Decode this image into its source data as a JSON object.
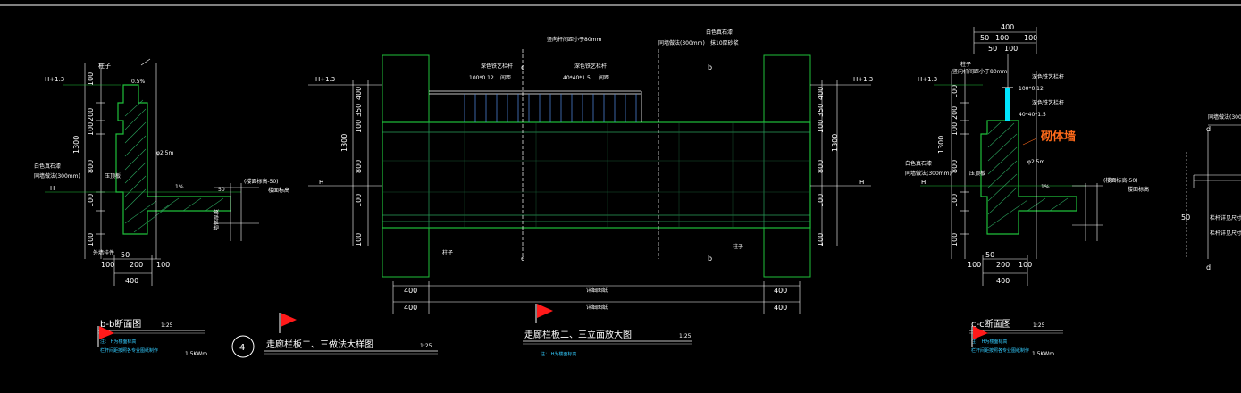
{
  "colors": {
    "background": "#000000",
    "line": "#ffffff",
    "structure": "#1fbf3a",
    "dim_green": "#2aa05a",
    "railing": "#4a7fd0",
    "cyan": "#00e5ff",
    "flag": "#ff1a1a",
    "annotation": "#ff6a1a"
  },
  "section_b": {
    "title": "b-b断面图",
    "scale": "1:25",
    "note": "注：  H为楼面标高",
    "note2": "栏杆间距按照各专业图纸制作",
    "sheet": "1.5KWm",
    "top_label": "柱子",
    "level_top": "H+1.3",
    "level_base": "H",
    "slope": "0.5%",
    "dims_v": [
      "100",
      "200",
      "100",
      "1300",
      "800",
      "100",
      "100",
      "100"
    ],
    "dims_h": [
      "100",
      "50",
      "200",
      "100"
    ],
    "total_h": "400",
    "label_finish": "白色真石漆",
    "label_wall": "同墙做法(300mm)",
    "label_cap": "压顶板",
    "label_rebar": "φ2.5m",
    "label_ground": "外墙保温",
    "label_floor": "(楼面标高-50)",
    "label_floor2": "楼面标高",
    "label_slab": "50",
    "label_side": "外墙挂件",
    "label_fix": "墙体",
    "label_side2": "墙体厚度",
    "label_ratio": "1%"
  },
  "section_c": {
    "title": "c-c断面图",
    "scale": "1:25",
    "note": "注：  H为楼面标高",
    "note2": "栏杆间距按照各专业图纸制作",
    "sheet": "1.5KWm",
    "top_label": "柱子",
    "level_top": "H+1.3",
    "level_base": "H",
    "red_label": "砌体墙",
    "top_dim": "400",
    "top_dims": [
      "50",
      "100",
      "100",
      "50",
      "100"
    ],
    "rail_a": "深色铁艺栏杆",
    "rail_a_size": "100*0.12",
    "rail_b": "深色铁艺栏杆",
    "rail_b_size": "40*40*1.5",
    "rail_gap": "竖向杆间距小于80mm",
    "dims_v": [
      "100",
      "200",
      "100",
      "1300",
      "800",
      "100",
      "100",
      "100"
    ],
    "dims_h": [
      "100",
      "50",
      "200",
      "100"
    ],
    "total_h": "400",
    "label_finish": "白色真石漆",
    "label_wall": "同墙做法(300mm)",
    "label_cap": "压顶板",
    "label_floor": "(楼面标高-50)",
    "label_floor2": "楼面标高",
    "label_ratio": "1%",
    "label_rebar": "φ2.5m"
  },
  "elevation": {
    "title": "走廊栏板二、三立面放大图",
    "scale": "1:25",
    "note": "注：  H为楼面标高",
    "top_label_1": "竖向杆间距小于80mm",
    "top_label_2": "白色真石漆",
    "top_label_3": "同墙做法(300mm)",
    "top_label_4": "抹10厚砂浆",
    "rail_a": "深色铁艺栏杆",
    "rail_a_size": "100*0.12",
    "rail_b": "深色铁艺栏杆",
    "rail_b_size": "40*40*1.5",
    "rail_note": "间距",
    "rail_note2": "间距",
    "mark_c": "c",
    "mark_b": "b",
    "col_label": "柱子",
    "level_top": "H+1.3",
    "level_base": "H",
    "dims_v": [
      "400",
      "350",
      "100",
      "1300",
      "800",
      "100",
      "100"
    ],
    "bottom_dims": [
      "400",
      "详细图纸",
      "400"
    ],
    "bottom_dims2": [
      "400",
      "详细图纸",
      "400"
    ]
  },
  "detail": {
    "number": "4",
    "title": "走廊栏板二、三做法大样图",
    "scale": "1:25"
  },
  "partial_right": {
    "label1": "同墙做法(300mm)",
    "label2": "d",
    "label3": "50",
    "label4": "栏杆详见尺寸",
    "label5": "栏杆详见尺寸",
    "label6": "d"
  }
}
